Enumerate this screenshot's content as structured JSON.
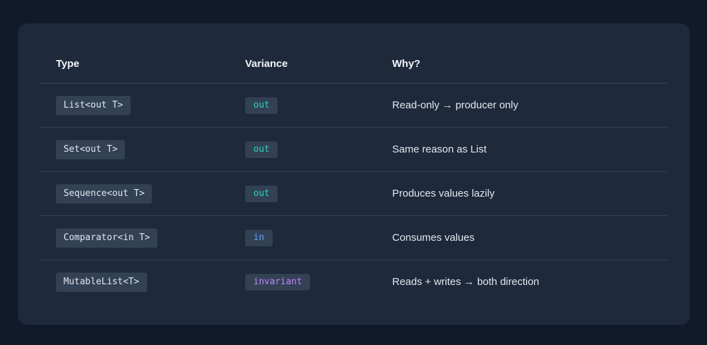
{
  "table": {
    "headers": [
      "Type",
      "Variance",
      "Why?"
    ],
    "rows": [
      {
        "type": "List<out T>",
        "variance": "out",
        "why": "Read-only → producer only"
      },
      {
        "type": "Set<out T>",
        "variance": "out",
        "why": "Same reason as List"
      },
      {
        "type": "Sequence<out T>",
        "variance": "out",
        "why": "Produces values lazily"
      },
      {
        "type": "Comparator<in T>",
        "variance": "in",
        "why": "Consumes values"
      },
      {
        "type": "MutableList<T>",
        "variance": "invariant",
        "why": "Reads + writes → both direction"
      }
    ]
  },
  "colors": {
    "page_background": "#111a2b",
    "card_background": "#1e293b",
    "out": "#2dd4bf",
    "in": "#60a5fa",
    "invariant": "#c084fc"
  }
}
